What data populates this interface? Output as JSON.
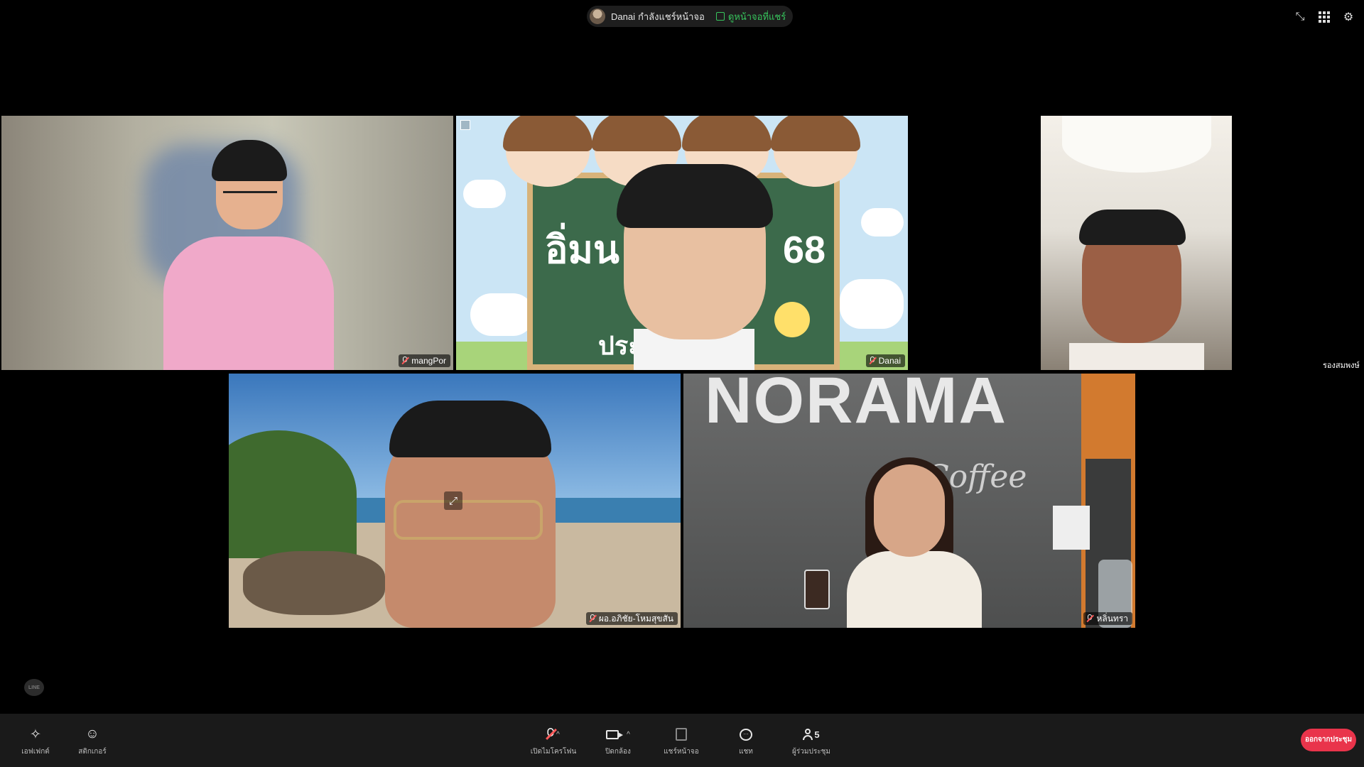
{
  "header": {
    "sharer_name": "Danai",
    "sharing_text": "กำลังแชร์หน้าจอ",
    "view_share_label": "ดูหน้าจอที่แชร์",
    "icons": [
      "collapse-icon",
      "grid-view-icon",
      "settings-icon"
    ]
  },
  "participants": [
    {
      "name": "mangPor",
      "mic": "off"
    },
    {
      "name": "Danai",
      "mic": "off",
      "background_text_1": "อิ่มน",
      "background_text_2": "68",
      "background_text_3": "ประ"
    },
    {
      "name": "รองสมพงษ์",
      "mic": "on"
    },
    {
      "name": "ผอ.อภิชัย-โหมสุขสัน",
      "mic": "off"
    },
    {
      "name": "หลิ่นทรา",
      "mic": "off",
      "background_text_1": "NORAMA",
      "background_text_2": "Coffee"
    }
  ],
  "watermark": "LINE",
  "toolbar": {
    "effects_label": "เอฟเฟกต์",
    "stickers_label": "สติกเกอร์",
    "mic_label": "เปิดไมโครโฟน",
    "camera_label": "ปิดกล้อง",
    "share_label": "แชร์หน้าจอ",
    "chat_label": "แชท",
    "participants_label": "ผู้ร่วมประชุม",
    "participants_count": "5",
    "leave_label": "ออกจากประชุม"
  },
  "colors": {
    "background": "#000000",
    "toolbar": "#1a1a1a",
    "leave": "#e9344b",
    "share_green": "#37c55d"
  }
}
